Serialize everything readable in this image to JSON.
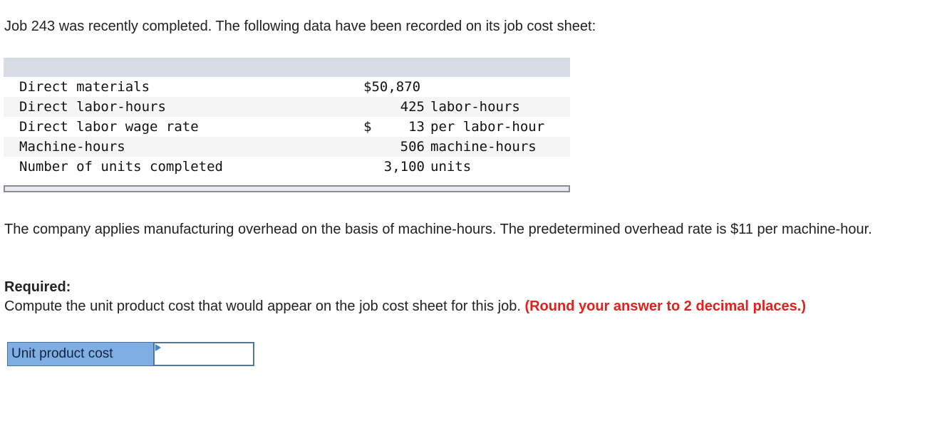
{
  "intro": "Job 243 was recently completed. The following data have been recorded on its job cost sheet:",
  "job_table": {
    "rows": [
      {
        "label": "Direct materials",
        "currency": "$",
        "amount": "50,870",
        "unit": "",
        "alt": false,
        "inline_currency": true
      },
      {
        "label": "Direct labor-hours",
        "currency": "",
        "amount": "425",
        "unit": "labor-hours",
        "alt": true,
        "inline_currency": false
      },
      {
        "label": "Direct labor wage rate",
        "currency": "$",
        "amount": "13",
        "unit": "per labor-hour",
        "alt": false,
        "inline_currency": false
      },
      {
        "label": "Machine-hours",
        "currency": "",
        "amount": "506",
        "unit": "machine-hours",
        "alt": true,
        "inline_currency": false
      },
      {
        "label": "Number of units completed",
        "currency": "",
        "amount": "3,100",
        "unit": "units",
        "alt": false,
        "inline_currency": false
      }
    ]
  },
  "paragraph": "The company applies manufacturing overhead on the basis of machine-hours. The predetermined overhead rate is $11 per machine-hour.",
  "required": {
    "heading": "Required:",
    "text": "Compute the unit product cost that would appear on the job cost sheet for this job.",
    "note": "(Round your answer to 2 decimal places.)"
  },
  "answer": {
    "label": "Unit product cost",
    "value": ""
  }
}
